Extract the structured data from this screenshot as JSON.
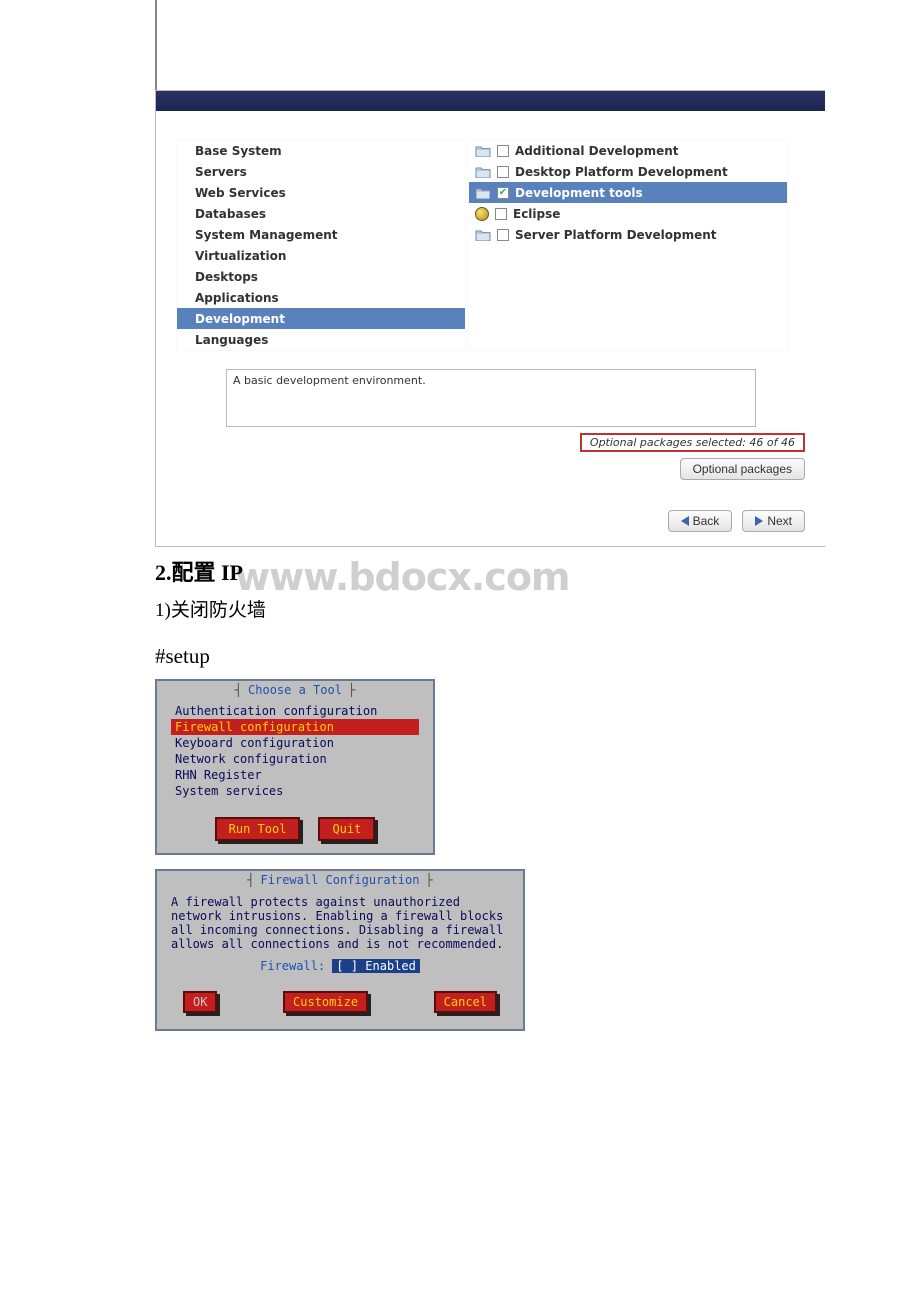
{
  "installer": {
    "left": [
      {
        "label": "Base System",
        "selected": false
      },
      {
        "label": "Servers",
        "selected": false
      },
      {
        "label": "Web Services",
        "selected": false
      },
      {
        "label": "Databases",
        "selected": false
      },
      {
        "label": "System Management",
        "selected": false
      },
      {
        "label": "Virtualization",
        "selected": false
      },
      {
        "label": "Desktops",
        "selected": false
      },
      {
        "label": "Applications",
        "selected": false
      },
      {
        "label": "Development",
        "selected": true
      },
      {
        "label": "Languages",
        "selected": false
      }
    ],
    "right": [
      {
        "label": "Additional Development",
        "checked": false,
        "selected": false,
        "icon": "folder"
      },
      {
        "label": "Desktop Platform Development",
        "checked": false,
        "selected": false,
        "icon": "folder"
      },
      {
        "label": "Development tools",
        "checked": true,
        "selected": true,
        "icon": "folder"
      },
      {
        "label": "Eclipse",
        "checked": false,
        "selected": false,
        "icon": "ball"
      },
      {
        "label": "Server Platform Development",
        "checked": false,
        "selected": false,
        "icon": "folder"
      }
    ],
    "description": "A basic development environment.",
    "status": "Optional packages selected: 46 of 46",
    "optional_button": "Optional packages",
    "back": "Back",
    "next": "Next"
  },
  "section": {
    "heading": "2.配置 IP",
    "sub": "1)关闭防火墙",
    "cmd": "#setup",
    "watermark": "www.bdocx.com"
  },
  "tui1": {
    "title": "Choose a Tool",
    "items": [
      {
        "label": "Authentication configuration",
        "selected": false
      },
      {
        "label": "Firewall configuration",
        "selected": true
      },
      {
        "label": "Keyboard configuration",
        "selected": false
      },
      {
        "label": "Network configuration",
        "selected": false
      },
      {
        "label": "RHN Register",
        "selected": false
      },
      {
        "label": "System services",
        "selected": false
      }
    ],
    "run": "Run Tool",
    "quit": "Quit"
  },
  "tui2": {
    "title": "Firewall Configuration",
    "body": "A firewall protects against unauthorized\nnetwork intrusions. Enabling a firewall blocks\nall incoming connections. Disabling a firewall\nallows all connections and is not recommended.",
    "fw_label": "Firewall:",
    "fw_value": "[ ] Enabled",
    "ok": "OK",
    "customize": "Customize",
    "cancel": "Cancel"
  }
}
